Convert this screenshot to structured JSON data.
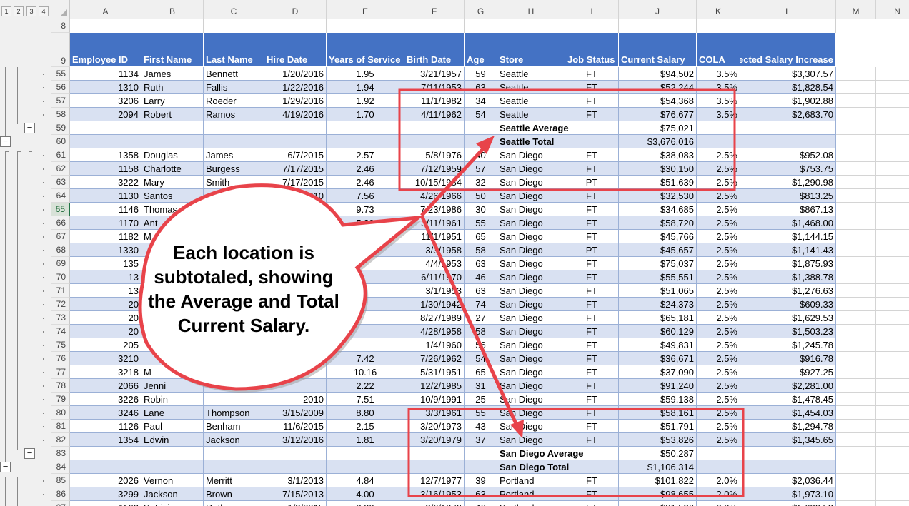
{
  "outline_levels": [
    "1",
    "2",
    "3",
    "4"
  ],
  "columns": [
    "A",
    "B",
    "C",
    "D",
    "E",
    "F",
    "G",
    "H",
    "I",
    "J",
    "K",
    "L",
    "M",
    "N"
  ],
  "header_row_numbers": [
    "8",
    "9"
  ],
  "headers": [
    "Employee ID",
    "First Name",
    "Last Name",
    "Hire Date",
    "Years of Service",
    "Birth Date",
    "Age",
    "Store",
    "Job Status",
    "Current Salary",
    "COLA",
    "Projected Salary Increase"
  ],
  "rows": [
    {
      "n": "55",
      "v": [
        "1134",
        "James",
        "Bennett",
        "1/20/2016",
        "1.95",
        "3/21/1957",
        "59",
        "Seattle",
        "FT",
        "$94,502",
        "3.5%",
        "$3,307.57"
      ]
    },
    {
      "n": "56",
      "v": [
        "1310",
        "Ruth",
        "Fallis",
        "1/22/2016",
        "1.94",
        "7/11/1953",
        "63",
        "Seattle",
        "FT",
        "$52,244",
        "3.5%",
        "$1,828.54"
      ]
    },
    {
      "n": "57",
      "v": [
        "3206",
        "Larry",
        "Roeder",
        "1/29/2016",
        "1.92",
        "11/1/1982",
        "34",
        "Seattle",
        "FT",
        "$54,368",
        "3.5%",
        "$1,902.88"
      ]
    },
    {
      "n": "58",
      "v": [
        "2094",
        "Robert",
        "Ramos",
        "4/19/2016",
        "1.70",
        "4/11/1962",
        "54",
        "Seattle",
        "FT",
        "$76,677",
        "3.5%",
        "$2,683.70"
      ]
    },
    {
      "n": "59",
      "v": [
        "",
        "",
        "",
        "",
        "",
        "",
        "",
        "Seattle Average",
        "",
        "$75,021",
        "",
        ""
      ],
      "sub": true
    },
    {
      "n": "60",
      "v": [
        "",
        "",
        "",
        "",
        "",
        "",
        "",
        "Seattle Total",
        "",
        "$3,676,016",
        "",
        ""
      ],
      "sub": true
    },
    {
      "n": "61",
      "v": [
        "1358",
        "Douglas",
        "James",
        "6/7/2015",
        "2.57",
        "5/8/1976",
        "40",
        "San Diego",
        "FT",
        "$38,083",
        "2.5%",
        "$952.08"
      ]
    },
    {
      "n": "62",
      "v": [
        "1158",
        "Charlotte",
        "Burgess",
        "7/17/2015",
        "2.46",
        "7/12/1959",
        "57",
        "San Diego",
        "FT",
        "$30,150",
        "2.5%",
        "$753.75"
      ]
    },
    {
      "n": "63",
      "v": [
        "3222",
        "Mary",
        "Smith",
        "7/17/2015",
        "2.46",
        "10/15/1984",
        "32",
        "San Diego",
        "PT",
        "$51,639",
        "2.5%",
        "$1,290.98"
      ]
    },
    {
      "n": "64",
      "v": [
        "1130",
        "Santos",
        "",
        "1/10/2010",
        "7.56",
        "4/26/1966",
        "50",
        "San Diego",
        "FT",
        "$32,530",
        "2.5%",
        "$813.25"
      ]
    },
    {
      "n": "65",
      "v": [
        "1146",
        "Thomas",
        "",
        "",
        "9.73",
        "7/23/1986",
        "30",
        "San Diego",
        "FT",
        "$34,685",
        "2.5%",
        "$867.13"
      ]
    },
    {
      "n": "66",
      "v": [
        "1170",
        "Ant",
        "",
        "",
        "5.32",
        "3/11/1961",
        "55",
        "San Diego",
        "FT",
        "$58,720",
        "2.5%",
        "$1,468.00"
      ]
    },
    {
      "n": "67",
      "v": [
        "1182",
        "M",
        "",
        "",
        "",
        "11/1/1951",
        "65",
        "San Diego",
        "FT",
        "$45,766",
        "2.5%",
        "$1,144.15"
      ]
    },
    {
      "n": "68",
      "v": [
        "1330",
        "",
        "",
        "",
        "",
        "3/3/1958",
        "58",
        "San Diego",
        "PT",
        "$45,657",
        "2.5%",
        "$1,141.43"
      ]
    },
    {
      "n": "69",
      "v": [
        "135",
        "",
        "",
        "",
        "",
        "4/4/1953",
        "63",
        "San Diego",
        "FT",
        "$75,037",
        "2.5%",
        "$1,875.93"
      ]
    },
    {
      "n": "70",
      "v": [
        "13",
        "",
        "",
        "",
        "",
        "6/11/1970",
        "46",
        "San Diego",
        "FT",
        "$55,551",
        "2.5%",
        "$1,388.78"
      ]
    },
    {
      "n": "71",
      "v": [
        "13",
        "",
        "",
        "",
        "",
        "3/1/1953",
        "63",
        "San Diego",
        "FT",
        "$51,065",
        "2.5%",
        "$1,276.63"
      ]
    },
    {
      "n": "72",
      "v": [
        "20",
        "",
        "",
        "",
        "",
        "1/30/1942",
        "74",
        "San Diego",
        "FT",
        "$24,373",
        "2.5%",
        "$609.33"
      ]
    },
    {
      "n": "73",
      "v": [
        "20",
        "",
        "",
        "",
        "",
        "8/27/1989",
        "27",
        "San Diego",
        "FT",
        "$65,181",
        "2.5%",
        "$1,629.53"
      ]
    },
    {
      "n": "74",
      "v": [
        "20",
        "",
        "",
        "",
        "",
        "4/28/1958",
        "58",
        "San Diego",
        "FT",
        "$60,129",
        "2.5%",
        "$1,503.23"
      ]
    },
    {
      "n": "75",
      "v": [
        "205",
        "",
        "",
        "",
        "",
        "1/4/1960",
        "56",
        "San Diego",
        "FT",
        "$49,831",
        "2.5%",
        "$1,245.78"
      ]
    },
    {
      "n": "76",
      "v": [
        "3210",
        "",
        "",
        "",
        "7.42",
        "7/26/1962",
        "54",
        "San Diego",
        "FT",
        "$36,671",
        "2.5%",
        "$916.78"
      ]
    },
    {
      "n": "77",
      "v": [
        "3218",
        "M",
        "",
        "",
        "10.16",
        "5/31/1951",
        "65",
        "San Diego",
        "FT",
        "$37,090",
        "2.5%",
        "$927.25"
      ]
    },
    {
      "n": "78",
      "v": [
        "2066",
        "Jenni",
        "",
        "",
        "2.22",
        "12/2/1985",
        "31",
        "San Diego",
        "FT",
        "$91,240",
        "2.5%",
        "$2,281.00"
      ]
    },
    {
      "n": "79",
      "v": [
        "3226",
        "Robin",
        "",
        "2010",
        "7.51",
        "10/9/1991",
        "25",
        "San Diego",
        "FT",
        "$59,138",
        "2.5%",
        "$1,478.45"
      ]
    },
    {
      "n": "80",
      "v": [
        "3246",
        "Lane",
        "Thompson",
        "3/15/2009",
        "8.80",
        "3/3/1961",
        "55",
        "San Diego",
        "FT",
        "$58,161",
        "2.5%",
        "$1,454.03"
      ]
    },
    {
      "n": "81",
      "v": [
        "1126",
        "Paul",
        "Benham",
        "11/6/2015",
        "2.15",
        "3/20/1973",
        "43",
        "San Diego",
        "FT",
        "$51,791",
        "2.5%",
        "$1,294.78"
      ]
    },
    {
      "n": "82",
      "v": [
        "1354",
        "Edwin",
        "Jackson",
        "3/12/2016",
        "1.81",
        "3/20/1979",
        "37",
        "San Diego",
        "FT",
        "$53,826",
        "2.5%",
        "$1,345.65"
      ]
    },
    {
      "n": "83",
      "v": [
        "",
        "",
        "",
        "",
        "",
        "",
        "",
        "San Diego Average",
        "",
        "$50,287",
        "",
        ""
      ],
      "sub": true
    },
    {
      "n": "84",
      "v": [
        "",
        "",
        "",
        "",
        "",
        "",
        "",
        "San Diego Total",
        "",
        "$1,106,314",
        "",
        ""
      ],
      "sub": true
    },
    {
      "n": "85",
      "v": [
        "2026",
        "Vernon",
        "Merritt",
        "3/1/2013",
        "4.84",
        "12/7/1977",
        "39",
        "Portland",
        "FT",
        "$101,822",
        "2.0%",
        "$2,036.44"
      ]
    },
    {
      "n": "86",
      "v": [
        "3299",
        "Jackson",
        "Brown",
        "7/15/2013",
        "4.00",
        "3/16/1953",
        "63",
        "Portland",
        "FT",
        "$98,655",
        "2.0%",
        "$1,973.10"
      ]
    },
    {
      "n": "87",
      "v": [
        "1162",
        "Patricia",
        "Ruth",
        "1/2/2015",
        "2.00",
        "2/6/1970",
        "46",
        "Portland",
        "FT",
        "$81,526",
        "2.0%",
        "$1,630.52"
      ]
    }
  ],
  "callout": "Each location is subtotaled, showing the Average and Total Current Salary.",
  "colors": {
    "header_blue": "#4472c4",
    "band": "#d9e1f2",
    "annotation_red": "#e8434a",
    "selected_row": "#217346"
  }
}
